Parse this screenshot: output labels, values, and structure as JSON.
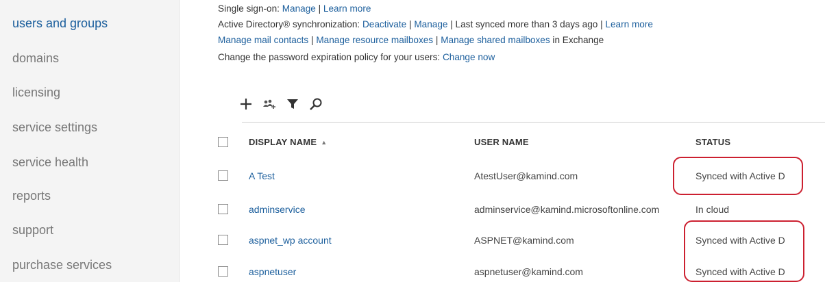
{
  "sidebar": {
    "items": [
      {
        "label": "users and groups",
        "active": true
      },
      {
        "label": "domains"
      },
      {
        "label": "licensing"
      },
      {
        "label": "service settings"
      },
      {
        "label": "service health"
      },
      {
        "label": "reports"
      },
      {
        "label": "support"
      },
      {
        "label": "purchase services"
      }
    ]
  },
  "info": {
    "sso": {
      "prefix": "Single sign-on: ",
      "manage": "Manage",
      "sep": " | ",
      "learn_more": "Learn more"
    },
    "ad_sync": {
      "prefix": "Active Directory® synchronization: ",
      "deactivate": "Deactivate",
      "sep1": " |  ",
      "manage": "Manage",
      "sep2": " |  Last synced more than 3 days ago | ",
      "learn_more": "Learn more"
    },
    "exchange": {
      "mail_contacts": "Manage mail contacts",
      "sep1": " | ",
      "resource_mailboxes": "Manage resource mailboxes",
      "sep2": " | ",
      "shared_mailboxes": "Manage shared mailboxes",
      "suffix": " in Exchange"
    },
    "password": {
      "prefix": "Change the password expiration policy for your users: ",
      "change_now": "Change now"
    }
  },
  "toolbar": {
    "icons": [
      "plus-icon",
      "users-add-icon",
      "filter-icon",
      "search-icon"
    ]
  },
  "table": {
    "headers": {
      "display_name": "DISPLAY NAME",
      "sort_indicator": "▲",
      "user_name": "USER NAME",
      "status": "STATUS"
    },
    "rows": [
      {
        "display_name": "A Test",
        "user_name": "AtestUser@kamind.com",
        "status": "Synced with Active D"
      },
      {
        "display_name": "adminservice",
        "user_name": "adminservice@kamind.microsoftonline.com",
        "status": "In cloud"
      },
      {
        "display_name": "aspnet_wp account",
        "user_name": "ASPNET@kamind.com",
        "status": "Synced with Active D"
      },
      {
        "display_name": "aspnetuser",
        "user_name": "aspnetuser@kamind.com",
        "status": "Synced with Active D"
      }
    ]
  },
  "colors": {
    "accent": "#1b5e9c",
    "highlight": "#cc2030",
    "sidebar_bg": "#f4f4f4"
  }
}
